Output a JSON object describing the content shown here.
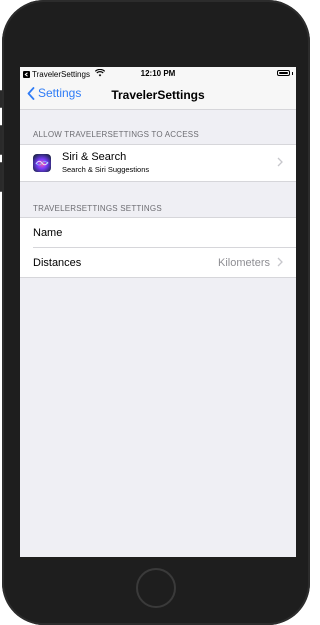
{
  "status_bar": {
    "back_app": "TravelerSettings",
    "time": "12:10 PM"
  },
  "nav": {
    "back_label": "Settings",
    "title": "TravelerSettings"
  },
  "sections": {
    "access_header": "ALLOW TRAVELERSETTINGS TO ACCESS",
    "settings_header": "TRAVELERSETTINGS SETTINGS"
  },
  "siri_row": {
    "title": "Siri & Search",
    "subtitle": "Search & Siri Suggestions"
  },
  "settings_rows": {
    "name_label": "Name",
    "distances_label": "Distances",
    "distances_value": "Kilometers"
  },
  "colors": {
    "accent": "#2f7cf6",
    "background": "#efeff4",
    "device": "#1e1e1e"
  },
  "icons": [
    "back-arrow-icon",
    "wifi-icon",
    "battery-icon",
    "chevron-left-icon",
    "siri-icon",
    "chevron-right-icon",
    "home-button"
  ]
}
